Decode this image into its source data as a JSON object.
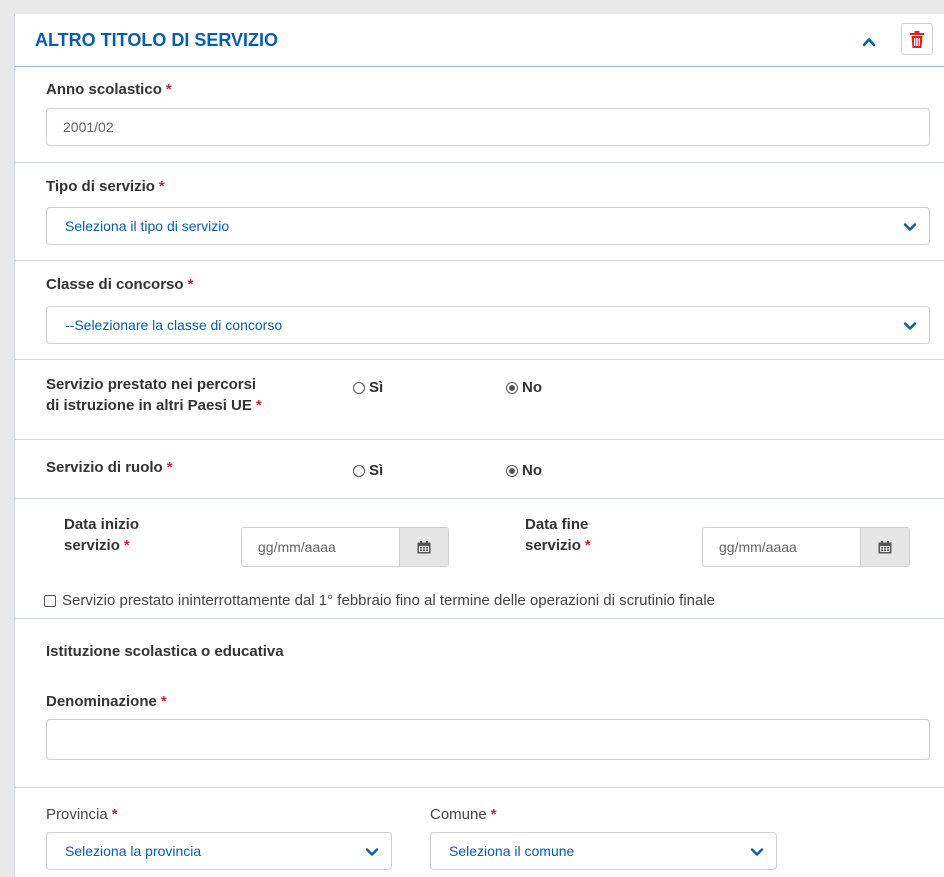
{
  "header": {
    "title": "ALTRO TITOLO DI SERVIZIO",
    "collapse_icon": "chevron-up-icon",
    "delete_icon": "trash-icon",
    "accent": "#0b5cad",
    "delete_color": "#d9241c"
  },
  "anno": {
    "label": "Anno scolastico",
    "required": "*",
    "value": "2001/02"
  },
  "tipo": {
    "label": "Tipo di servizio",
    "required": "*",
    "selected": "Seleziona il tipo di servizio"
  },
  "classe": {
    "label": "Classe di concorso",
    "required": "*",
    "selected": "--Selezionare la classe di concorso"
  },
  "ue": {
    "label_line1": "Servizio prestato nei percorsi",
    "label_line2": "di istruzione in altri Paesi UE",
    "required": "*",
    "yes": "Sì",
    "no": "No",
    "selected": "No"
  },
  "ruolo": {
    "label": "Servizio di ruolo",
    "required": "*",
    "yes": "Sì",
    "no": "No",
    "selected": "No"
  },
  "date": {
    "inizio_line1": "Data inizio",
    "inizio_line2": "servizio",
    "fine_line1": "Data fine",
    "fine_line2": "servizio",
    "required": "*",
    "placeholder": "gg/mm/aaaa",
    "checkbox_label": "Servizio prestato ininterrottamente dal 1° febbraio fino al termine delle operazioni di scrutinio finale",
    "checked": false
  },
  "istituzione": {
    "heading": "Istituzione scolastica o educativa",
    "denominazione_label": "Denominazione",
    "required": "*",
    "denominazione_value": ""
  },
  "luogo": {
    "provincia_label": "Provincia",
    "comune_label": "Comune",
    "required": "*",
    "provincia_selected": "Seleziona la provincia",
    "comune_selected": "Seleziona il comune"
  }
}
